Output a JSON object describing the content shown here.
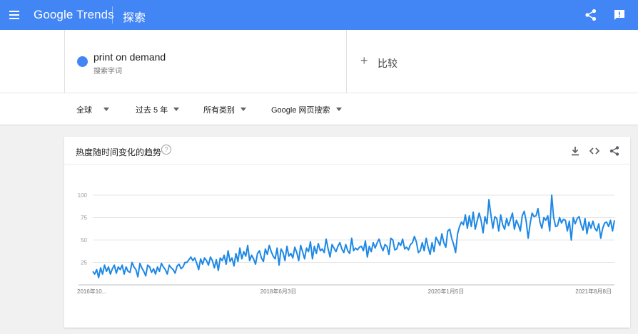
{
  "topbar": {
    "logo_google": "Google",
    "logo_trends": "Trends",
    "title": "探索",
    "color": "#4285f4"
  },
  "search": {
    "term": "print on demand",
    "term_type": "搜索字词",
    "term_color": "#4285f4",
    "compare_label": "比较"
  },
  "filters": {
    "region": "全球",
    "time": "过去 5 年",
    "category": "所有类别",
    "property": "Google 网页搜索"
  },
  "card": {
    "title": "热度随时间变化的趋势",
    "help": "?"
  },
  "chart_data": {
    "type": "line",
    "series": [
      {
        "color": "#1e88e5",
        "values": [
          15,
          12,
          17,
          8,
          19,
          12,
          22,
          15,
          20,
          12,
          18,
          22,
          13,
          20,
          17,
          22,
          12,
          20,
          15,
          14,
          25,
          20,
          17,
          9,
          24,
          19,
          15,
          10,
          22,
          20,
          14,
          18,
          12,
          20,
          15,
          24,
          20,
          17,
          12,
          22,
          19,
          17,
          13,
          21,
          23,
          18,
          20,
          25,
          25,
          28,
          31,
          27,
          30,
          24,
          17,
          29,
          23,
          30,
          27,
          22,
          31,
          27,
          19,
          28,
          16,
          30,
          27,
          33,
          23,
          38,
          26,
          30,
          21,
          35,
          26,
          41,
          29,
          37,
          32,
          44,
          27,
          33,
          29,
          23,
          35,
          38,
          30,
          26,
          40,
          34,
          44,
          37,
          32,
          29,
          41,
          22,
          40,
          36,
          27,
          43,
          32,
          35,
          30,
          42,
          36,
          27,
          44,
          37,
          29,
          41,
          37,
          48,
          29,
          43,
          35,
          46,
          38,
          40,
          36,
          51,
          40,
          31,
          45,
          41,
          37,
          43,
          47,
          40,
          36,
          45,
          38,
          35,
          52,
          38,
          41,
          39,
          42,
          43,
          38,
          49,
          31,
          43,
          37,
          47,
          41,
          47,
          51,
          43,
          38,
          45,
          43,
          34,
          52,
          50,
          39,
          40,
          47,
          44,
          51,
          40,
          42,
          39,
          45,
          47,
          54,
          48,
          36,
          38,
          47,
          38,
          52,
          42,
          34,
          47,
          37,
          53,
          49,
          44,
          57,
          47,
          42,
          60,
          62,
          52,
          45,
          36,
          57,
          65,
          70,
          67,
          78,
          63,
          77,
          65,
          81,
          62,
          71,
          80,
          72,
          58,
          76,
          68,
          95,
          78,
          63,
          76,
          74,
          60,
          78,
          67,
          62,
          74,
          66,
          73,
          80,
          62,
          72,
          67,
          60,
          77,
          82,
          71,
          52,
          68,
          80,
          76,
          77,
          85,
          70,
          63,
          75,
          72,
          77,
          60,
          100,
          75,
          65,
          66,
          75,
          69,
          73,
          72,
          60,
          71,
          50,
          75,
          68,
          74,
          76,
          67,
          61,
          74,
          57,
          70,
          63,
          71,
          63,
          60,
          68,
          52,
          63,
          69,
          70,
          65,
          72,
          60,
          72
        ],
        "labels_raw": ""
      }
    ],
    "x_tick_labels": [
      "2016年10...",
      "2018年6月3日",
      "2020年1月5日",
      "2021年8月8日"
    ],
    "y_tick_labels": [
      "100",
      "75",
      "50",
      "25"
    ],
    "ylim": [
      0,
      100
    ],
    "grid": true
  }
}
